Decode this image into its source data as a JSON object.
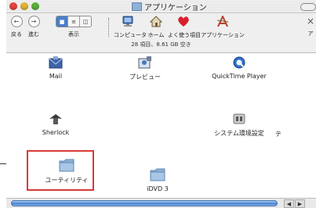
{
  "window": {
    "title": "アプリケーション"
  },
  "toolbar": {
    "back_label": "戻る",
    "forward_label": "進む",
    "view_label": "表示",
    "computer_label": "コンピュータ",
    "home_label": "ホーム",
    "favorites_label": "よく使う項目",
    "applications_label": "アプリケーション",
    "cut_label": "ア"
  },
  "status": {
    "text": "28 項目、8.61 GB 空き"
  },
  "items": [
    {
      "label": "Mail"
    },
    {
      "label": "プレビュー"
    },
    {
      "label": "QuickTime Player"
    },
    {
      "label": "Sherlock"
    },
    {
      "label": "システム環境設定"
    },
    {
      "label": "テ"
    },
    {
      "label": "ユーティリティ"
    },
    {
      "label": "iDVD 3"
    }
  ],
  "colors": {
    "highlight": "#d83a36",
    "folder": "#8fb1d6"
  }
}
